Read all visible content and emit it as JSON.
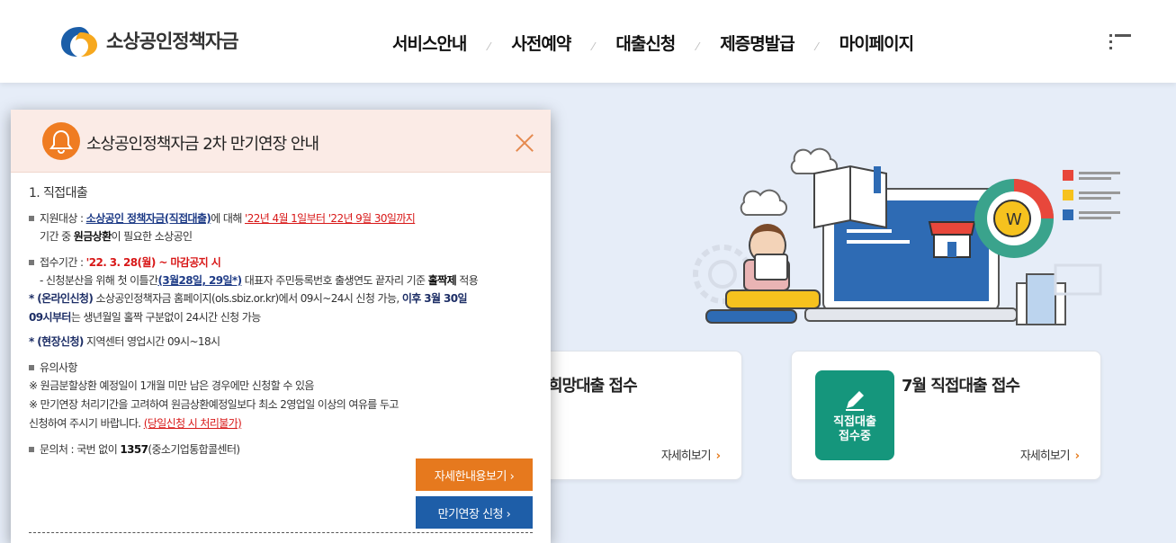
{
  "header": {
    "logo_text": "소상공인정책자금",
    "nav": [
      "서비스안내",
      "사전예약",
      "대출신청",
      "제증명발급",
      "마이페이지"
    ],
    "nav_separator": "⁄"
  },
  "cards": [
    {
      "title": "희망대출 접수",
      "more": "자세히보기"
    },
    {
      "title": "7월 직접대출 접수",
      "more": "자세히보기",
      "badge_line1": "직접대출",
      "badge_line2": "접수중"
    }
  ],
  "modal": {
    "title": "소상공인정책자금 2차 만기연장 안내",
    "section": "1. 직접대출",
    "target_label": "지원대상 : ",
    "target_fund": "소상공인 정책자금(직접대출)",
    "target_mid": "에 대해 ",
    "target_period": "'22년 4월 1일부터 '22년 9월 30일까지",
    "target_line2_pre": "기간 중 ",
    "target_line2_bold": "원금상환",
    "target_line2_post": "이 필요한 소상공인",
    "apply_label": "접수기간 : ",
    "apply_deadline": "'22. 3. 28(월) ~ 마감공지 시",
    "apply_note_pre": "- 신청분산을 위해 첫 이틀간",
    "apply_note_dates": "(3월28일, 29일*)",
    "apply_note_post": " 대표자 주민등록번호 출생연도 끝자리 기준 ",
    "apply_note_bold": "홀짝제",
    "apply_note_end": " 적용",
    "online_label": "* (온라인신청)",
    "online_text": " 소상공인정책자금 홈페이지(ols.sbiz.or.kr)에서 09시~24시 신청 가능, ",
    "online_bold": "이후 3월 30일",
    "online_line2_bold": "09시부터",
    "online_line2": "는 생년월일 홀짝 구분없이 24시간 신청 가능",
    "onsite_label": "* (현장신청)",
    "onsite_text": " 지역센터 영업시간 09시~18시",
    "notice_title": "유의사항",
    "notice1": "※ 원금분할상환 예정일이 1개월 미만 남은 경우에만 신청할 수 있음",
    "notice2": "※ 만기연장 처리기간을 고려하여 원금상환예정일보다 최소 2영업일 이상의 여유를 두고",
    "notice3_pre": "신청하여 주시기 바랍니다. ",
    "notice3_red": "(당일신청 시 처리불가)",
    "contact_pre": "문의처 : 국번 없이 ",
    "contact_bold": "1357",
    "contact_post": "(중소기업통합콜센터)",
    "btn_detail": "자세한내용보기 ›",
    "btn_apply": "만기연장 신청 ›"
  }
}
